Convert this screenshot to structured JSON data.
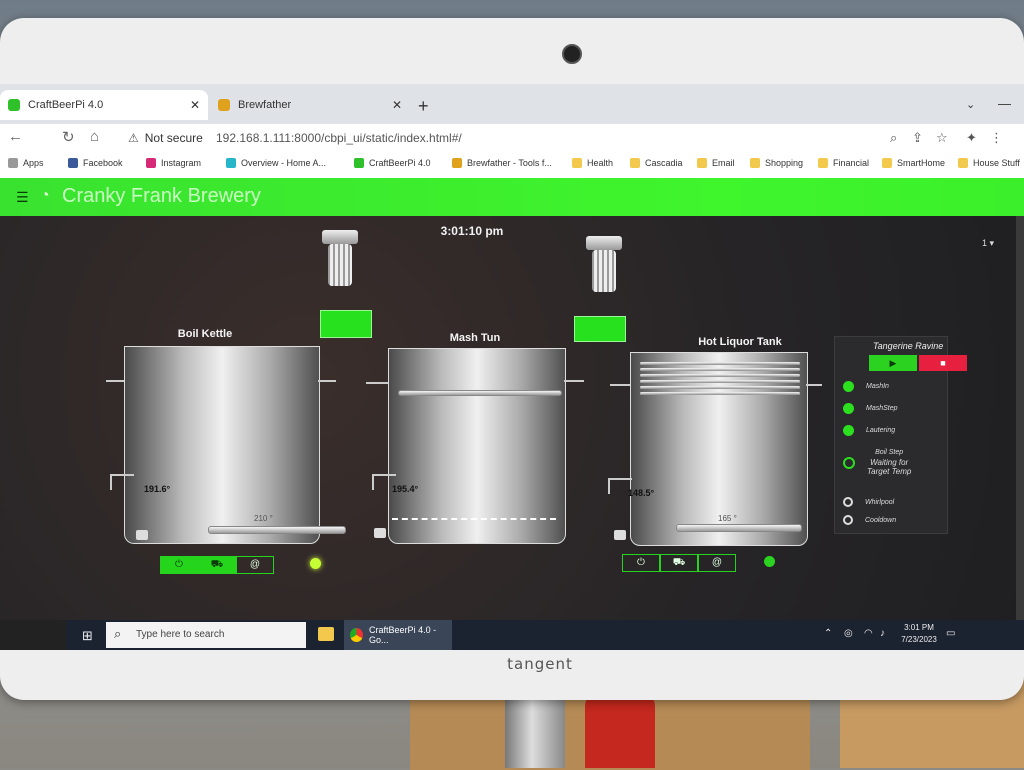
{
  "browser": {
    "tabs": [
      {
        "label": "CraftBeerPi 4.0",
        "active": true
      },
      {
        "label": "Brewfather",
        "active": false
      }
    ],
    "new_tab": "+",
    "security": "Not secure",
    "url": "192.168.1.111:8000/cbpi_ui/static/index.html#/",
    "bookmarks": [
      "Apps",
      "Facebook",
      "Instagram",
      "Overview - Home A...",
      "CraftBeerPi 4.0",
      "Brewfather - Tools f...",
      "Health",
      "Cascadia",
      "Email",
      "Shopping",
      "Financial",
      "SmartHome",
      "House Stuff"
    ]
  },
  "app": {
    "title": "Cranky Frank Brewery",
    "clock": "3:01:10 pm",
    "page_selector": "1",
    "vessels": {
      "boil_kettle": {
        "name": "Boil Kettle",
        "temp": "191.6°",
        "target": "210 °"
      },
      "mash_tun": {
        "name": "Mash Tun",
        "temp": "195.4°"
      },
      "hlt": {
        "name": "Hot Liquor Tank",
        "temp": "148.5°",
        "target": "165 °"
      }
    },
    "pump1_label": "",
    "pump2_label": "",
    "controls": {
      "power_icon": "⏻",
      "car_icon": "⛟",
      "spiral_icon": "@"
    },
    "recipe": {
      "name": "Tangerine Ravine",
      "start_icon": "▶",
      "stop_icon": "■",
      "steps": [
        {
          "label": "MashIn",
          "state": "done"
        },
        {
          "label": "MashStep",
          "state": "done"
        },
        {
          "label": "Lautering",
          "state": "done"
        },
        {
          "label": "Boil Step",
          "state": "active",
          "note1": "Waiting for",
          "note2": "Target Temp"
        },
        {
          "label": "Whirlpool",
          "state": "pending"
        },
        {
          "label": "Cooldown",
          "state": "pending"
        }
      ]
    }
  },
  "taskbar": {
    "search_placeholder": "Type here to search",
    "chrome_label": "CraftBeerPi 4.0 - Go...",
    "time": "3:01 PM",
    "date": "7/23/2023"
  },
  "monitor_brand": "tangent",
  "colors": {
    "accent": "#3ff52c",
    "stop": "#e8203f"
  }
}
